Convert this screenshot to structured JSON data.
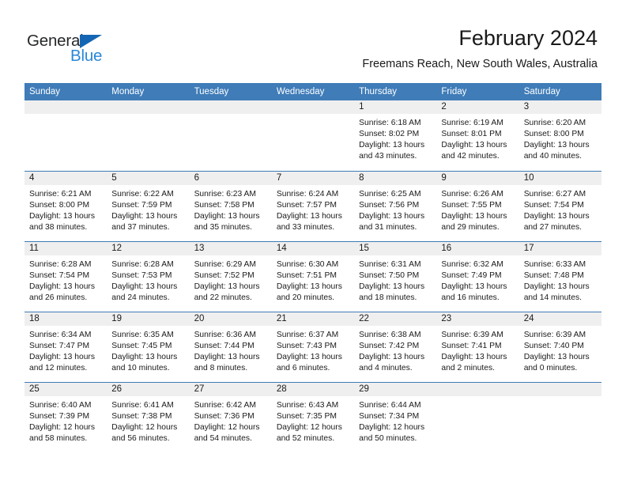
{
  "logo": {
    "word_one": "General",
    "word_two": "Blue",
    "triangle_color": "#1565b5",
    "blue_color": "#2a87d8",
    "dark_color": "#26282a"
  },
  "header": {
    "title": "February 2024",
    "subtitle": "Freemans Reach, New South Wales, Australia"
  },
  "theme": {
    "header_row_bg": "#3f7cb8",
    "daynum_bg": "#efefef",
    "text": "#1a1a1a"
  },
  "weekdays": [
    "Sunday",
    "Monday",
    "Tuesday",
    "Wednesday",
    "Thursday",
    "Friday",
    "Saturday"
  ],
  "weeks": [
    [
      {
        "day": "",
        "empty": true
      },
      {
        "day": "",
        "empty": true
      },
      {
        "day": "",
        "empty": true
      },
      {
        "day": "",
        "empty": true
      },
      {
        "day": "1",
        "sunrise": "Sunrise: 6:18 AM",
        "sunset": "Sunset: 8:02 PM",
        "daylight": "Daylight: 13 hours and 43 minutes."
      },
      {
        "day": "2",
        "sunrise": "Sunrise: 6:19 AM",
        "sunset": "Sunset: 8:01 PM",
        "daylight": "Daylight: 13 hours and 42 minutes."
      },
      {
        "day": "3",
        "sunrise": "Sunrise: 6:20 AM",
        "sunset": "Sunset: 8:00 PM",
        "daylight": "Daylight: 13 hours and 40 minutes."
      }
    ],
    [
      {
        "day": "4",
        "sunrise": "Sunrise: 6:21 AM",
        "sunset": "Sunset: 8:00 PM",
        "daylight": "Daylight: 13 hours and 38 minutes."
      },
      {
        "day": "5",
        "sunrise": "Sunrise: 6:22 AM",
        "sunset": "Sunset: 7:59 PM",
        "daylight": "Daylight: 13 hours and 37 minutes."
      },
      {
        "day": "6",
        "sunrise": "Sunrise: 6:23 AM",
        "sunset": "Sunset: 7:58 PM",
        "daylight": "Daylight: 13 hours and 35 minutes."
      },
      {
        "day": "7",
        "sunrise": "Sunrise: 6:24 AM",
        "sunset": "Sunset: 7:57 PM",
        "daylight": "Daylight: 13 hours and 33 minutes."
      },
      {
        "day": "8",
        "sunrise": "Sunrise: 6:25 AM",
        "sunset": "Sunset: 7:56 PM",
        "daylight": "Daylight: 13 hours and 31 minutes."
      },
      {
        "day": "9",
        "sunrise": "Sunrise: 6:26 AM",
        "sunset": "Sunset: 7:55 PM",
        "daylight": "Daylight: 13 hours and 29 minutes."
      },
      {
        "day": "10",
        "sunrise": "Sunrise: 6:27 AM",
        "sunset": "Sunset: 7:54 PM",
        "daylight": "Daylight: 13 hours and 27 minutes."
      }
    ],
    [
      {
        "day": "11",
        "sunrise": "Sunrise: 6:28 AM",
        "sunset": "Sunset: 7:54 PM",
        "daylight": "Daylight: 13 hours and 26 minutes."
      },
      {
        "day": "12",
        "sunrise": "Sunrise: 6:28 AM",
        "sunset": "Sunset: 7:53 PM",
        "daylight": "Daylight: 13 hours and 24 minutes."
      },
      {
        "day": "13",
        "sunrise": "Sunrise: 6:29 AM",
        "sunset": "Sunset: 7:52 PM",
        "daylight": "Daylight: 13 hours and 22 minutes."
      },
      {
        "day": "14",
        "sunrise": "Sunrise: 6:30 AM",
        "sunset": "Sunset: 7:51 PM",
        "daylight": "Daylight: 13 hours and 20 minutes."
      },
      {
        "day": "15",
        "sunrise": "Sunrise: 6:31 AM",
        "sunset": "Sunset: 7:50 PM",
        "daylight": "Daylight: 13 hours and 18 minutes."
      },
      {
        "day": "16",
        "sunrise": "Sunrise: 6:32 AM",
        "sunset": "Sunset: 7:49 PM",
        "daylight": "Daylight: 13 hours and 16 minutes."
      },
      {
        "day": "17",
        "sunrise": "Sunrise: 6:33 AM",
        "sunset": "Sunset: 7:48 PM",
        "daylight": "Daylight: 13 hours and 14 minutes."
      }
    ],
    [
      {
        "day": "18",
        "sunrise": "Sunrise: 6:34 AM",
        "sunset": "Sunset: 7:47 PM",
        "daylight": "Daylight: 13 hours and 12 minutes."
      },
      {
        "day": "19",
        "sunrise": "Sunrise: 6:35 AM",
        "sunset": "Sunset: 7:45 PM",
        "daylight": "Daylight: 13 hours and 10 minutes."
      },
      {
        "day": "20",
        "sunrise": "Sunrise: 6:36 AM",
        "sunset": "Sunset: 7:44 PM",
        "daylight": "Daylight: 13 hours and 8 minutes."
      },
      {
        "day": "21",
        "sunrise": "Sunrise: 6:37 AM",
        "sunset": "Sunset: 7:43 PM",
        "daylight": "Daylight: 13 hours and 6 minutes."
      },
      {
        "day": "22",
        "sunrise": "Sunrise: 6:38 AM",
        "sunset": "Sunset: 7:42 PM",
        "daylight": "Daylight: 13 hours and 4 minutes."
      },
      {
        "day": "23",
        "sunrise": "Sunrise: 6:39 AM",
        "sunset": "Sunset: 7:41 PM",
        "daylight": "Daylight: 13 hours and 2 minutes."
      },
      {
        "day": "24",
        "sunrise": "Sunrise: 6:39 AM",
        "sunset": "Sunset: 7:40 PM",
        "daylight": "Daylight: 13 hours and 0 minutes."
      }
    ],
    [
      {
        "day": "25",
        "sunrise": "Sunrise: 6:40 AM",
        "sunset": "Sunset: 7:39 PM",
        "daylight": "Daylight: 12 hours and 58 minutes."
      },
      {
        "day": "26",
        "sunrise": "Sunrise: 6:41 AM",
        "sunset": "Sunset: 7:38 PM",
        "daylight": "Daylight: 12 hours and 56 minutes."
      },
      {
        "day": "27",
        "sunrise": "Sunrise: 6:42 AM",
        "sunset": "Sunset: 7:36 PM",
        "daylight": "Daylight: 12 hours and 54 minutes."
      },
      {
        "day": "28",
        "sunrise": "Sunrise: 6:43 AM",
        "sunset": "Sunset: 7:35 PM",
        "daylight": "Daylight: 12 hours and 52 minutes."
      },
      {
        "day": "29",
        "sunrise": "Sunrise: 6:44 AM",
        "sunset": "Sunset: 7:34 PM",
        "daylight": "Daylight: 12 hours and 50 minutes."
      },
      {
        "day": "",
        "empty": true
      },
      {
        "day": "",
        "empty": true
      }
    ]
  ]
}
